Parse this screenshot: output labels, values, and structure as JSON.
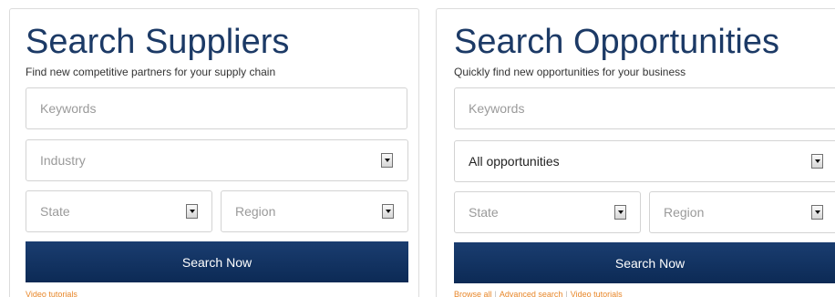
{
  "suppliers": {
    "title": "Search Suppliers",
    "subtitle": "Find new competitive partners for your supply chain",
    "keywords_placeholder": "Keywords",
    "industry_placeholder": "Industry",
    "state_placeholder": "State",
    "region_placeholder": "Region",
    "search_button": "Search Now",
    "video_link": "Video tutorials"
  },
  "opportunities": {
    "title": "Search Opportunities",
    "subtitle": "Quickly find new opportunities for your business",
    "keywords_placeholder": "Keywords",
    "type_value": "All opportunities",
    "state_placeholder": "State",
    "region_placeholder": "Region",
    "search_button": "Search Now",
    "links": {
      "browse_all": "Browse all",
      "advanced_search": "Advanced search",
      "video_tutorials": "Video tutorials",
      "separator": "|"
    }
  },
  "colors": {
    "title": "#1c3a66",
    "button": "#0c2a55",
    "link": "#e8872a",
    "border": "#dcdcdc"
  }
}
